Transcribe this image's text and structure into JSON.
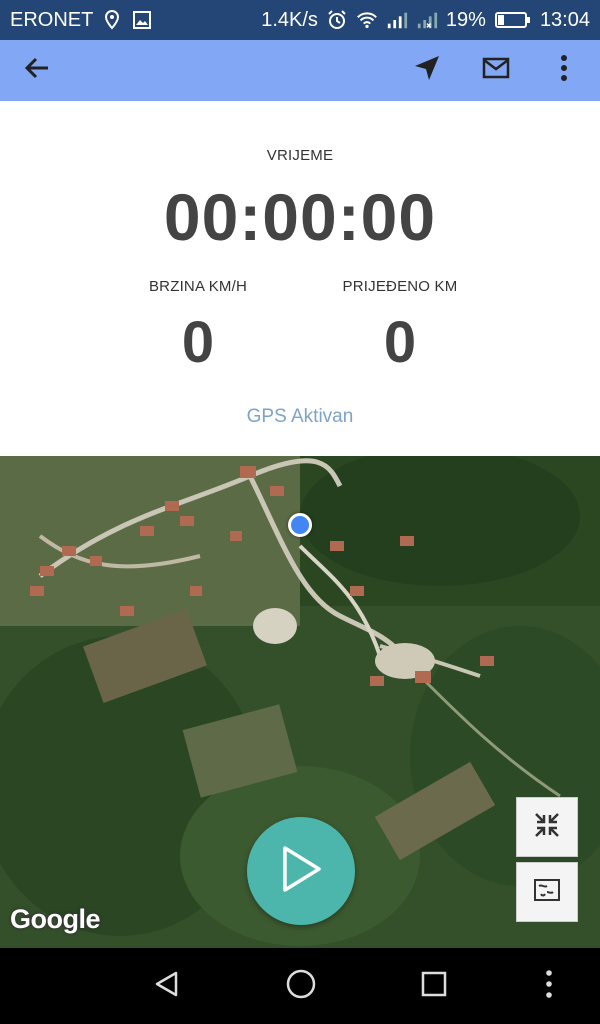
{
  "status_bar": {
    "carrier": "ERONET",
    "net_speed": "1.4K/s",
    "battery": "19%",
    "time": "13:04",
    "icons": [
      "location-icon",
      "image-icon",
      "alarm-icon",
      "wifi-icon",
      "signal-icon",
      "signal-off-icon",
      "battery-icon"
    ]
  },
  "toolbar": {
    "background": "#82a7f4",
    "icons": [
      "back-arrow-icon",
      "navigation-icon",
      "mail-icon",
      "more-vert-icon"
    ]
  },
  "stats": {
    "time_label": "VRIJEME",
    "time_value": "00:00:00",
    "speed_label": "BRZINA KM/H",
    "speed_value": "0",
    "distance_label": "PRIJEĐENO KM",
    "distance_value": "0",
    "gps_status": "GPS Aktivan"
  },
  "map": {
    "attribution": "Google",
    "controls": [
      "collapse-icon",
      "map-type-icon"
    ],
    "play_color": "#4db6ac"
  },
  "navbar": {
    "icons": [
      "nav-back-icon",
      "nav-home-icon",
      "nav-recents-icon",
      "nav-more-icon"
    ]
  }
}
